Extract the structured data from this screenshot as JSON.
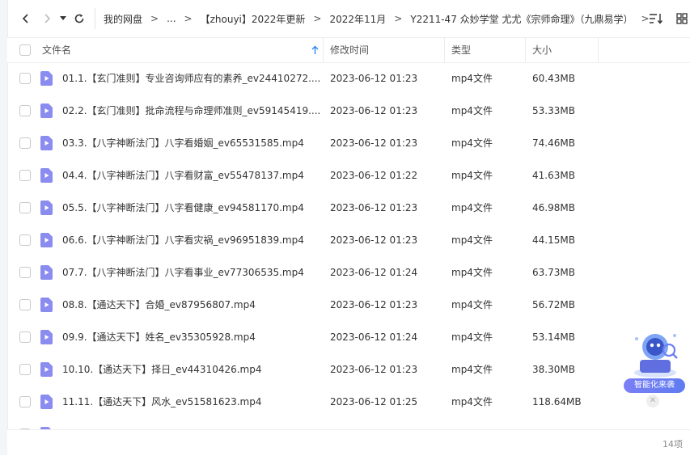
{
  "nav": {
    "back_icon": "chevron-left-icon",
    "forward_icon": "chevron-right-icon",
    "dropdown_icon": "caret-down-icon",
    "refresh_icon": "refresh-icon"
  },
  "breadcrumbs": [
    "我的网盘",
    "...",
    "【zhouyi】2022年更新",
    "2022年11月",
    "Y2211-47 众妙学堂 尤尤《宗师命理》（九鼎易学）"
  ],
  "columns": {
    "name": "文件名",
    "modified": "修改时间",
    "type": "类型",
    "size": "大小"
  },
  "sort": {
    "column": "name",
    "direction": "ascending",
    "icon": "sort-up-arrow-icon"
  },
  "files": [
    {
      "name": "01.1.【玄门准则】专业咨询师应有的素养_ev24410272....",
      "modified": "2023-06-12 01:23",
      "type": "mp4文件",
      "size": "60.43MB"
    },
    {
      "name": "02.2.【玄门准则】批命流程与命理师准则_ev59145419....",
      "modified": "2023-06-12 01:23",
      "type": "mp4文件",
      "size": "53.33MB"
    },
    {
      "name": "03.3.【八字神断法门】八字看婚姻_ev65531585.mp4",
      "modified": "2023-06-12 01:23",
      "type": "mp4文件",
      "size": "74.46MB"
    },
    {
      "name": "04.4.【八字神断法门】八字看财富_ev55478137.mp4",
      "modified": "2023-06-12 01:22",
      "type": "mp4文件",
      "size": "41.63MB"
    },
    {
      "name": "05.5.【八字神断法门】八字看健康_ev94581170.mp4",
      "modified": "2023-06-12 01:23",
      "type": "mp4文件",
      "size": "46.98MB"
    },
    {
      "name": "06.6.【八字神断法门】八字看灾祸_ev96951839.mp4",
      "modified": "2023-06-12 01:23",
      "type": "mp4文件",
      "size": "44.15MB"
    },
    {
      "name": "07.7.【八字神断法门】八字看事业_ev77306535.mp4",
      "modified": "2023-06-12 01:24",
      "type": "mp4文件",
      "size": "63.73MB"
    },
    {
      "name": "08.8.【通达天下】合婚_ev87956807.mp4",
      "modified": "2023-06-12 01:23",
      "type": "mp4文件",
      "size": "56.72MB"
    },
    {
      "name": "09.9.【通达天下】姓名_ev35305928.mp4",
      "modified": "2023-06-12 01:24",
      "type": "mp4文件",
      "size": "53.14MB"
    },
    {
      "name": "10.10.【通达天下】择日_ev44310426.mp4",
      "modified": "2023-06-12 01:23",
      "type": "mp4文件",
      "size": "38.30MB"
    },
    {
      "name": "11.11.【通达天下】风水_ev51581623.mp4",
      "modified": "2023-06-12 01:25",
      "type": "mp4文件",
      "size": "118.64MB"
    },
    {
      "name": "",
      "modified": "",
      "type": "",
      "size": ""
    }
  ],
  "footer": {
    "count": "14项"
  },
  "assistant": {
    "label": "智能化来袭",
    "close_icon": "close-icon"
  },
  "colors": {
    "video_icon": "#8b8cf0",
    "sort_arrow": "#2f86f6",
    "assistant": "#6d7ef3"
  }
}
